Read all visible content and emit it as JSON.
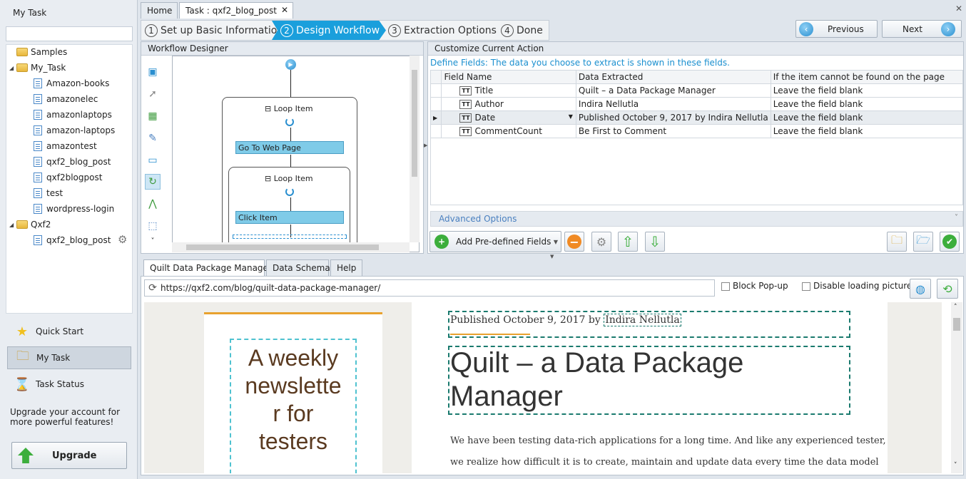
{
  "sidebar": {
    "title": "My Task",
    "search_placeholder": "",
    "tree": [
      {
        "label": "Samples",
        "type": "folder",
        "expandable": false
      },
      {
        "label": "My_Task",
        "type": "folder",
        "expandable": true
      },
      {
        "label": "Amazon-books",
        "type": "task"
      },
      {
        "label": "amazonelec",
        "type": "task"
      },
      {
        "label": "amazonlaptops",
        "type": "task"
      },
      {
        "label": "amazon-laptops",
        "type": "task"
      },
      {
        "label": "amazontest",
        "type": "task"
      },
      {
        "label": "qxf2_blog_post",
        "type": "task"
      },
      {
        "label": "qxf2blogpost",
        "type": "task"
      },
      {
        "label": "test",
        "type": "task"
      },
      {
        "label": "wordpress-login",
        "type": "task"
      },
      {
        "label": "Qxf2",
        "type": "folder",
        "expandable": true
      },
      {
        "label": "qxf2_blog_post",
        "type": "task"
      }
    ],
    "quick_start": "Quick Start",
    "my_task": "My Task",
    "task_status": "Task Status",
    "upgrade_text": "Upgrade your account for more powerful features!",
    "upgrade_button": "Upgrade"
  },
  "tabs": {
    "home": "Home",
    "task": "Task : qxf2_blog_post"
  },
  "steps": [
    {
      "num": "1",
      "label": "Set up Basic Information"
    },
    {
      "num": "2",
      "label": "Design Workflow"
    },
    {
      "num": "3",
      "label": "Extraction Options"
    },
    {
      "num": "4",
      "label": "Done"
    }
  ],
  "nav": {
    "previous": "Previous",
    "next": "Next"
  },
  "workflow": {
    "title": "Workflow Designer",
    "loop1": "Loop Item",
    "go_to_web_page": "Go To Web Page",
    "loop2": "Loop Item",
    "click_item": "Click Item"
  },
  "action": {
    "title": "Customize Current Action",
    "define_fields": "Define Fields: The data you choose to extract is shown in these fields.",
    "columns": [
      "Field Name",
      "Data Extracted",
      "If the item cannot be found on the page"
    ],
    "rows": [
      {
        "field": "Title",
        "data": "Quilt – a Data Package Manager",
        "missing": "Leave the field blank"
      },
      {
        "field": "Author",
        "data": "Indira Nellutla",
        "missing": "Leave the field blank"
      },
      {
        "field": "Date",
        "data": "Published October 9, 2017 by Indira Nellutla",
        "missing": "Leave the field blank"
      },
      {
        "field": "CommentCount",
        "data": "Be First to Comment",
        "missing": "Leave the field blank"
      }
    ],
    "advanced": "Advanced Options",
    "add_predefined": "Add Pre-defined Fields"
  },
  "browser_tabs": [
    "Quilt Data Package Manager",
    "Data Schema",
    "Help"
  ],
  "browser": {
    "url": "https://qxf2.com/blog/quilt-data-package-manager/",
    "block_popup": "Block Pop-up",
    "disable_pictures": "Disable loading pictures"
  },
  "webpage": {
    "newsletter": "A weekly newsletter for testers",
    "published": "Published October 9, 2017 by ",
    "author": "Indira Nellutla",
    "heading": "Quilt – a Data Package Manager",
    "para1": "We have been testing data-rich applications for a long time. And like any experienced tester,",
    "para2": "we realize how difficult it is to create, maintain and update data every time the data model"
  },
  "colors": {
    "accent": "#1a9fdc",
    "action_box": "#7fcbe8",
    "selection_dash": "#1a7a6e"
  }
}
